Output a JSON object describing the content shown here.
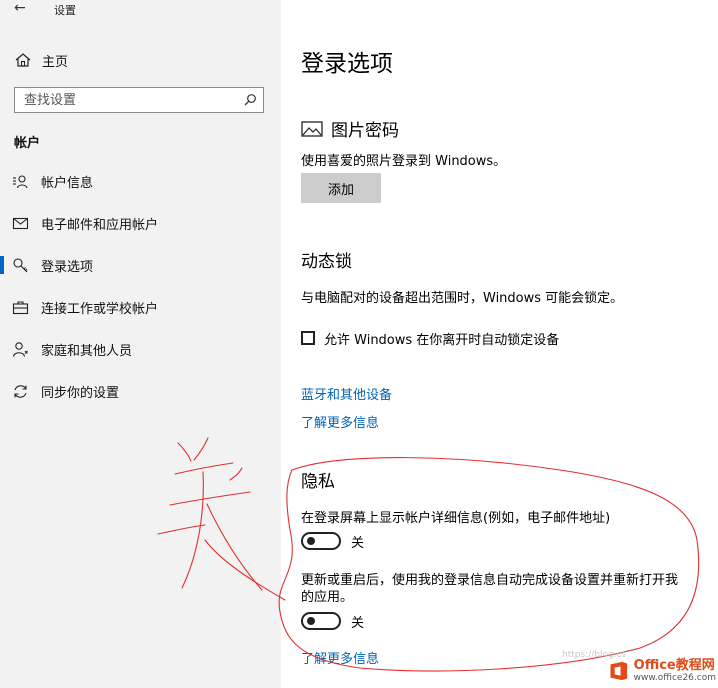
{
  "titlebar": {
    "title": "设置"
  },
  "sidebar": {
    "home_label": "主页",
    "search_placeholder": "查找设置",
    "section_title": "帐户",
    "items": [
      {
        "label": "帐户信息",
        "icon": "account-info-icon"
      },
      {
        "label": "电子邮件和应用帐户",
        "icon": "mail-icon"
      },
      {
        "label": "登录选项",
        "icon": "key-icon",
        "selected": true
      },
      {
        "label": "连接工作或学校帐户",
        "icon": "briefcase-icon"
      },
      {
        "label": "家庭和其他人员",
        "icon": "person-icon"
      },
      {
        "label": "同步你的设置",
        "icon": "sync-icon"
      }
    ]
  },
  "main": {
    "title": "登录选项",
    "picture_password": {
      "heading": "图片密码",
      "description": "使用喜爱的照片登录到 Windows。",
      "button": "添加"
    },
    "dynamic_lock": {
      "heading": "动态锁",
      "description": "与电脑配对的设备超出范围时，Windows 可能会锁定。",
      "checkbox_label": "允许 Windows 在你离开时自动锁定设备",
      "checked": false,
      "link_bluetooth": "蓝牙和其他设备",
      "link_learn_more": "了解更多信息"
    },
    "privacy": {
      "heading": "隐私",
      "setting1": "在登录屏幕上显示帐户详细信息(例如，电子邮件地址)",
      "toggle1_state": "关",
      "setting2_line1": "更新或重启后，使用我的登录信息自动完成设备设置并重新打开我",
      "setting2_line2": "的应用。",
      "toggle2_state": "关",
      "link_learn_more": "了解更多信息"
    }
  },
  "annotation": {
    "handwritten_text": "关",
    "color": "#e03030"
  },
  "watermark": {
    "brand": "Office教程网",
    "site": "www.office26.com"
  },
  "blog_watermark": "https://blog.cs",
  "colors": {
    "accent": "#0066c8",
    "link": "#0063b1",
    "sidebar_bg": "#f2f2f2",
    "annotation": "#e03030"
  }
}
